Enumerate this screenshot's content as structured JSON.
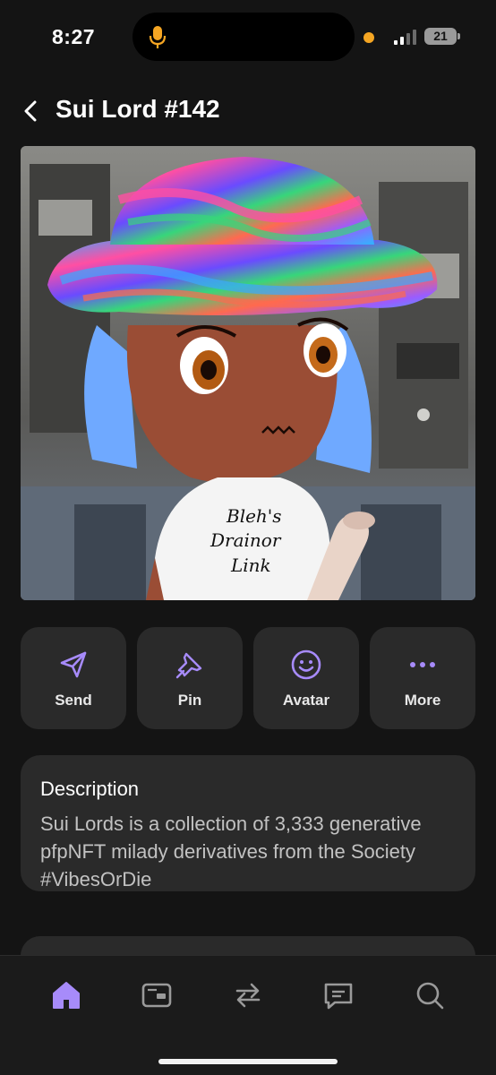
{
  "status_bar": {
    "time": "8:27",
    "battery": "21",
    "camera_indicator_color": "#f5a623",
    "mic_color": "#f5a623"
  },
  "header": {
    "title": "Sui Lord #142"
  },
  "nft": {
    "shirt_text_line1": "Bleh's",
    "shirt_text_line2": "Drainor",
    "shirt_text_line3": "Link"
  },
  "actions": [
    {
      "label": "Send",
      "icon": "send-icon"
    },
    {
      "label": "Pin",
      "icon": "pin-icon"
    },
    {
      "label": "Avatar",
      "icon": "smiley-icon"
    },
    {
      "label": "More",
      "icon": "more-dots-icon"
    }
  ],
  "description": {
    "title": "Description",
    "text": "Sui Lords is a collection of 3,333 generative pfpNFT milady derivatives from the Society #VibesOrDie"
  },
  "bottom_nav": [
    {
      "icon": "home-icon",
      "active": true
    },
    {
      "icon": "wallet-card-icon",
      "active": false
    },
    {
      "icon": "swap-icon",
      "active": false
    },
    {
      "icon": "chat-icon",
      "active": false
    },
    {
      "icon": "search-icon",
      "active": false
    }
  ],
  "colors": {
    "accent": "#a78bfa",
    "background": "#141414",
    "card": "#2a2a2a"
  }
}
